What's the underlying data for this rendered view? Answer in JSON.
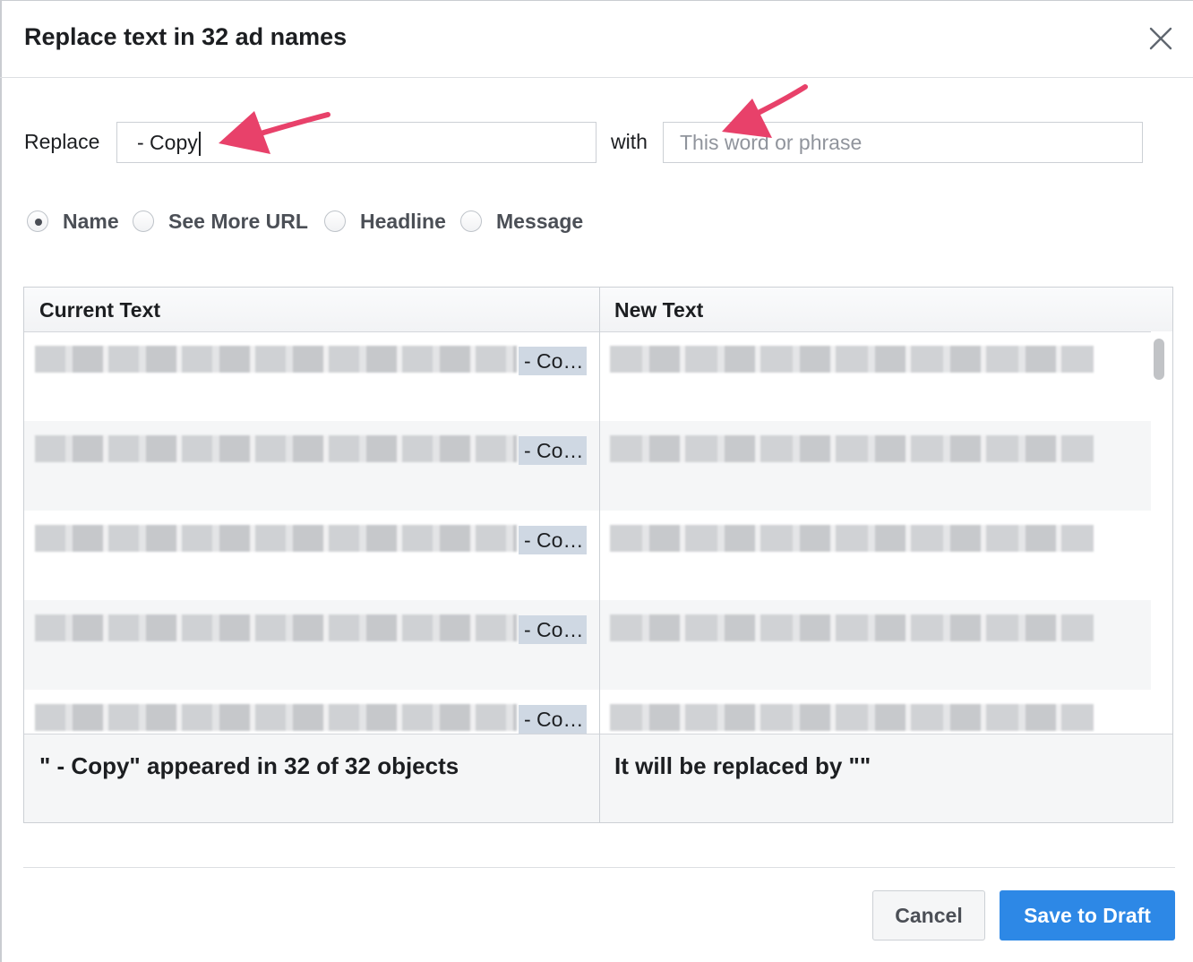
{
  "dialog": {
    "title": "Replace text in 32 ad names"
  },
  "form": {
    "replace_label": "Replace",
    "replace_value": " - Copy",
    "with_label": "with",
    "with_placeholder": "This word or phrase"
  },
  "fields": [
    {
      "label": "Name",
      "selected": true
    },
    {
      "label": "See More URL",
      "selected": false
    },
    {
      "label": "Headline",
      "selected": false
    },
    {
      "label": "Message",
      "selected": false
    }
  ],
  "table": {
    "col_current": "Current Text",
    "col_new": "New Text",
    "rows": [
      {
        "match": "- Co…"
      },
      {
        "match": "- Co…"
      },
      {
        "match": "- Co…"
      },
      {
        "match": "- Co…"
      },
      {
        "match": "- Co…"
      }
    ],
    "summary_left": "\" - Copy\" appeared in 32 of 32 objects",
    "summary_right": "It will be replaced by \"\""
  },
  "buttons": {
    "cancel": "Cancel",
    "save": "Save to Draft"
  },
  "colors": {
    "primary": "#2d88e6",
    "annotation_arrow": "#e8416a",
    "match_highlight": "#cfd8e3"
  }
}
